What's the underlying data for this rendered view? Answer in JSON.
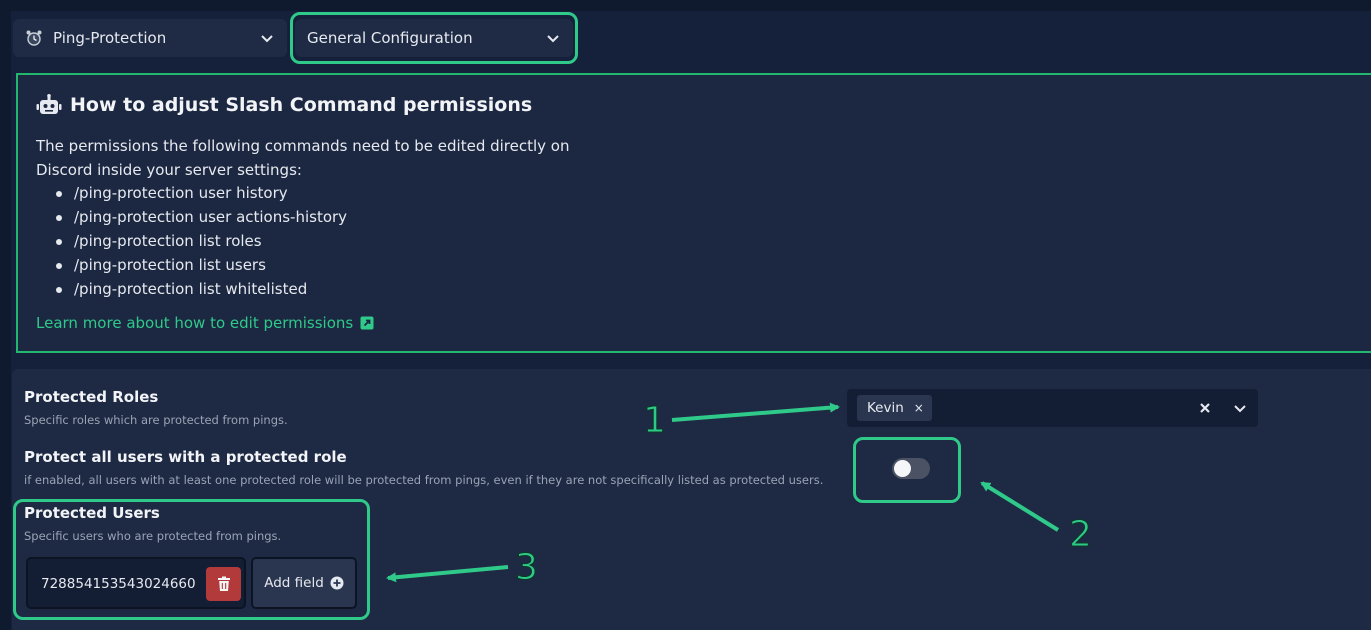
{
  "header": {
    "module_select": {
      "value": "Ping-Protection"
    },
    "config_select": {
      "value": "General Configuration"
    }
  },
  "info": {
    "title": "How to adjust Slash Command permissions",
    "description": "The permissions the following commands need to be edited directly on Discord inside your server settings:",
    "commands": [
      "/ping-protection user history",
      "/ping-protection user actions-history",
      "/ping-protection list roles",
      "/ping-protection list users",
      "/ping-protection list whitelisted"
    ],
    "link_text": "Learn more about how to edit permissions"
  },
  "settings": {
    "protected_roles": {
      "label": "Protected Roles",
      "desc": "Specific roles which are protected from pings.",
      "selected": [
        "Kevin"
      ]
    },
    "protect_all": {
      "label": "Protect all users with a protected role",
      "desc": "if enabled, all users with at least one protected role will be protected from pings, even if they are not specifically listed as protected users.",
      "enabled": false
    },
    "protected_users": {
      "label": "Protected Users",
      "desc": "Specific users who are protected from pings.",
      "values": [
        "728854153543024660"
      ],
      "add_label": "Add field"
    }
  },
  "annotations": {
    "one": "1",
    "two": "2",
    "three": "3"
  },
  "colors": {
    "accent": "#2fc98a",
    "danger": "#b33a3a",
    "background": "#15213a"
  }
}
